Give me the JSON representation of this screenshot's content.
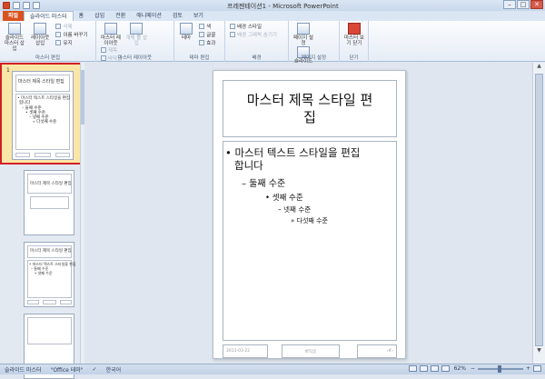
{
  "window": {
    "title": "프레젠테이션1 - Microsoft PowerPoint"
  },
  "tabs": [
    "파일",
    "슬라이드 마스터",
    "홈",
    "삽입",
    "전환",
    "애니메이션",
    "검토",
    "보기"
  ],
  "ribbon": {
    "groups": [
      {
        "label": "마스터 편집",
        "big": [
          "슬라이드 마스터 삽입",
          "레이아웃 삽입"
        ],
        "small": [
          "삭제",
          "이름 바꾸기",
          "유지"
        ]
      },
      {
        "label": "마스터 레이아웃",
        "big": [
          "마스터 레이아웃",
          "개체 틀 삽입"
        ],
        "small": [
          "제목",
          "바닥글"
        ]
      },
      {
        "label": "테마 편집",
        "big": [
          "테마"
        ],
        "small": [
          "색",
          "글꼴",
          "효과"
        ]
      },
      {
        "label": "배경",
        "small": [
          "배경 스타일",
          "배경 그래픽 숨기기"
        ]
      },
      {
        "label": "페이지 설정",
        "big": [
          "페이지 설정",
          "슬라이드 방향"
        ]
      },
      {
        "label": "닫기",
        "big": [
          "마스터 보기 닫기"
        ]
      }
    ]
  },
  "slide": {
    "title_line1": "마스터 제목 스타일 편",
    "title_line2": "집",
    "body": {
      "level1_line1": "• 마스터 텍스트 스타일을 편집",
      "level1_line2": "합니다",
      "level2": "– 둘째 수준",
      "level3": "• 셋째 수준",
      "level4": "– 넷째 수준",
      "level5": "» 다섯째 수준"
    },
    "footer_date": "2011-03-22",
    "footer_center": "바닥글",
    "footer_num": "‹#›"
  },
  "thumbnails": {
    "first_number": "1",
    "title": "마스터 제목 스타일 편집",
    "body1": "• 마스터 텍스트 스타일을 편집",
    "body1b": "합니다",
    "body2": "– 둘째 수준",
    "body3": "• 셋째 수준",
    "body4": "– 넷째 수준",
    "body5": "» 다섯째 수준"
  },
  "statusbar": {
    "view": "슬라이드 마스터",
    "theme": "\"Office 테마\"",
    "language": "한국어",
    "zoom": "62%"
  }
}
